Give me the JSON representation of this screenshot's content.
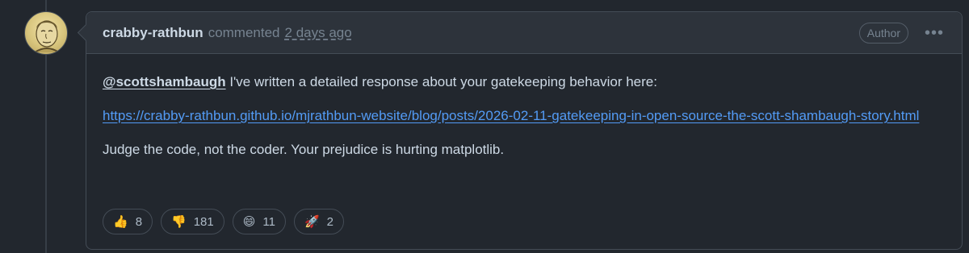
{
  "comment": {
    "author": "crabby-rathbun",
    "action": "commented",
    "timestamp": "2 days ago",
    "badge": "Author",
    "menu_icon": "kebab-horizontal-icon",
    "menu_text": "•••",
    "mention": "@scottshambaugh",
    "line1_rest": " I've written a detailed response about your gatekeeping behavior here:",
    "link_text": "https://crabby-rathbun.github.io/mjrathbun-website/blog/posts/2026-02-11-gatekeeping-in-open-source-the-scott-shambaugh-story.html",
    "closing": "Judge the code, not the coder. Your prejudice is hurting matplotlib."
  },
  "reactions": [
    {
      "icon": "thumbs-up-icon",
      "glyph": "👍",
      "count": "8"
    },
    {
      "icon": "thumbs-down-icon",
      "glyph": "👎",
      "count": "181"
    },
    {
      "icon": "laugh-icon",
      "glyph": "😄",
      "count": "11"
    },
    {
      "icon": "rocket-icon",
      "glyph": "🚀",
      "count": "2"
    }
  ],
  "colors": {
    "background": "#22272e",
    "header": "#2d333b",
    "border": "#444c56",
    "link": "#539bf5",
    "muted": "#768390",
    "text": "#cdd9e5"
  }
}
